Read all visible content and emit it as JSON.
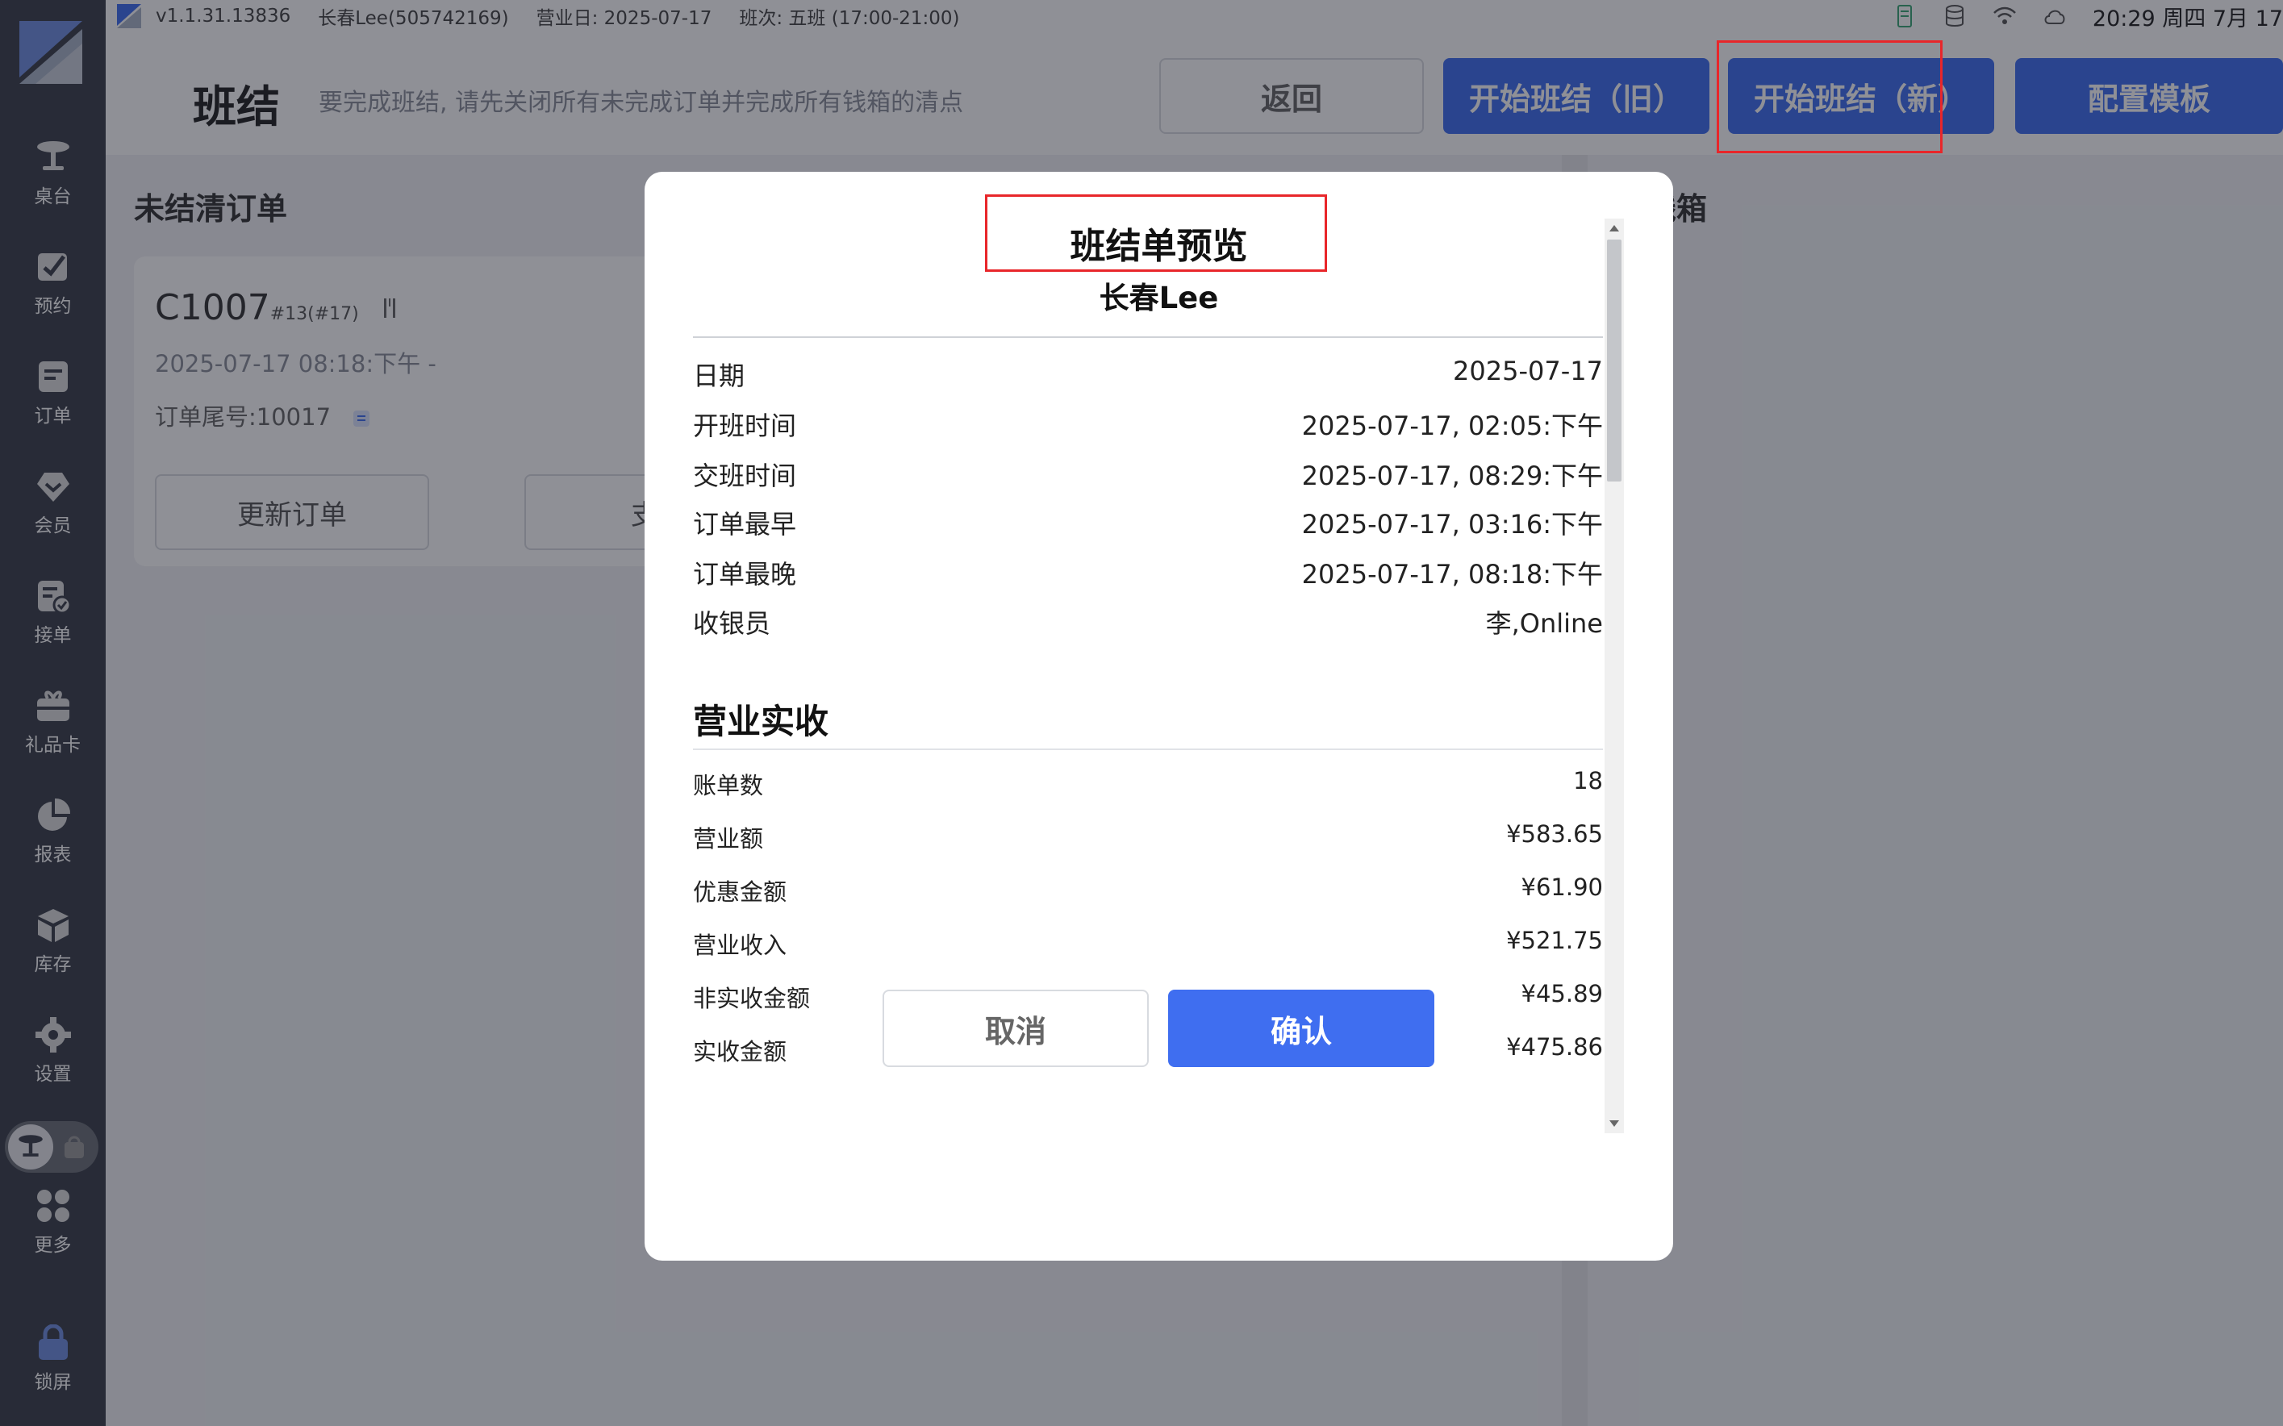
{
  "status_bar": {
    "version": "v1.1.31.13836",
    "store": "长春Lee(505742169)",
    "business_day": "营业日: 2025-07-17",
    "shift": "班次:  五班 (17:00-21:00)",
    "clock": "20:29 周四 7月 17"
  },
  "sidebar": {
    "items": [
      {
        "label": "桌台",
        "icon": "table-icon"
      },
      {
        "label": "预约",
        "icon": "reservation-icon"
      },
      {
        "label": "订单",
        "icon": "order-icon"
      },
      {
        "label": "会员",
        "icon": "member-icon"
      },
      {
        "label": "接单",
        "icon": "accept-order-icon"
      },
      {
        "label": "礼品卡",
        "icon": "gift-card-icon"
      },
      {
        "label": "报表",
        "icon": "report-icon"
      },
      {
        "label": "库存",
        "icon": "inventory-icon"
      },
      {
        "label": "设置",
        "icon": "settings-icon"
      },
      {
        "label": "更多",
        "icon": "more-icon"
      },
      {
        "label": "锁屏",
        "icon": "lock-icon"
      }
    ]
  },
  "header": {
    "title": "班结",
    "hint": "要完成班结, 请先关闭所有未完成订单并完成所有钱箱的清点",
    "back_label": "返回",
    "start_old_label": "开始班结（旧）",
    "start_new_label": "开始班结（新）",
    "template_label": "配置模板"
  },
  "left_panel": {
    "section_title": "未结清订单",
    "order": {
      "number": "C1007",
      "table_ref": "#13(#17)",
      "time": "2025-07-17 08:18:下午   -",
      "tail": "订单尾号:10017",
      "update_label": "更新订单",
      "other_label": "支"
    }
  },
  "right_panel": {
    "section_title": "钱箱"
  },
  "modal": {
    "title": "班结单预览",
    "subtitle": "长春Lee",
    "info_rows": [
      {
        "label": "日期",
        "value": "2025-07-17"
      },
      {
        "label": "开班时间",
        "value": "2025-07-17, 02:05:下午"
      },
      {
        "label": "交班时间",
        "value": "2025-07-17, 08:29:下午"
      },
      {
        "label": "订单最早",
        "value": "2025-07-17, 03:16:下午"
      },
      {
        "label": "订单最晚",
        "value": "2025-07-17, 08:18:下午"
      },
      {
        "label": "收银员",
        "value": "李,Online"
      }
    ],
    "revenue_section_title": "营业实收",
    "revenue_rows": [
      {
        "label": "账单数",
        "value": "18"
      },
      {
        "label": "营业额",
        "value": "¥583.65"
      },
      {
        "label": "优惠金额",
        "value": "¥61.90"
      },
      {
        "label": "营业收入",
        "value": "¥521.75"
      },
      {
        "label": "非实收金额",
        "value": "¥45.89"
      },
      {
        "label": "实收金额",
        "value": "¥475.86"
      }
    ],
    "cancel_label": "取消",
    "confirm_label": "确认"
  },
  "colors": {
    "primary": "#3f6ef0",
    "sidebar": "#3a3f4a",
    "highlight": "#e8262a"
  }
}
